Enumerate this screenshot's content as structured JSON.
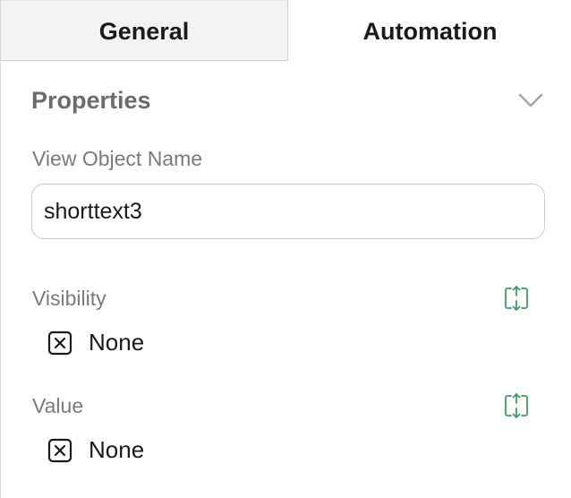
{
  "tabs": [
    {
      "label": "General",
      "active": false
    },
    {
      "label": "Automation",
      "active": true
    }
  ],
  "properties": {
    "title": "Properties",
    "view_object_name": {
      "label": "View Object Name",
      "value": "shorttext3"
    },
    "visibility": {
      "label": "Visibility",
      "value": "None",
      "icon": "expand-vertical-icon"
    },
    "value_field": {
      "label": "Value",
      "value": "None",
      "icon": "expand-vertical-icon"
    }
  },
  "colors": {
    "accent_green": "#3f9a63",
    "label_gray": "#7a7a7a",
    "title_gray": "#6b6b6b"
  }
}
